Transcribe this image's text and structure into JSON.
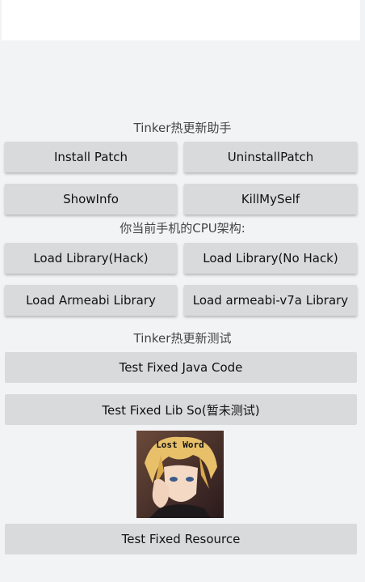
{
  "labels": {
    "title1": "Tinker热更新助手",
    "cpu": "你当前手机的CPU架构:",
    "title2": "Tinker热更新测试"
  },
  "buttons": {
    "install_patch": "Install Patch",
    "uninstall_patch": "UninstallPatch",
    "show_info": "ShowInfo",
    "kill_myself": "KillMySelf",
    "load_lib_hack": "Load Library(Hack)",
    "load_lib_nohack": "Load Library(No Hack)",
    "load_armeabi": "Load Armeabi Library",
    "load_armeabi_v7a": "Load armeabi-v7a Library",
    "test_java": "Test Fixed Java Code",
    "test_lib_so": "Test Fixed Lib So(暂未测试)",
    "test_resource": "Test Fixed Resource"
  },
  "image": {
    "caption": "Lost Word"
  }
}
